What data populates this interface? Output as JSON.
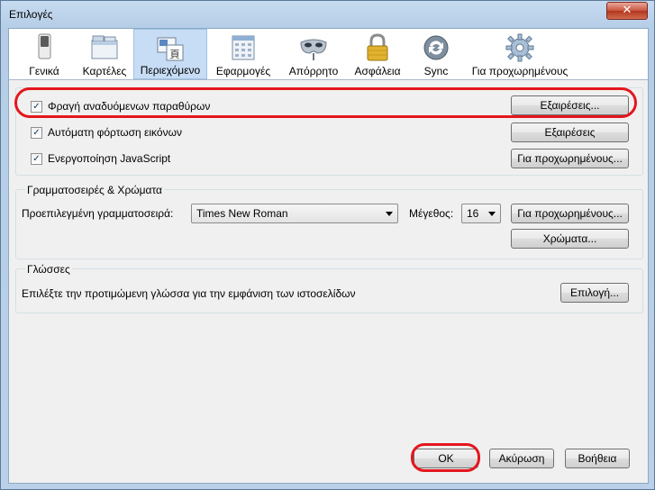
{
  "window": {
    "title": "Επιλογές",
    "close_glyph": "✕"
  },
  "toolbar": {
    "tabs": [
      {
        "label": "Γενικά",
        "icon": "switch-icon"
      },
      {
        "label": "Καρτέλες",
        "icon": "tabs-icon"
      },
      {
        "label": "Περιεχόμενο",
        "icon": "content-icon"
      },
      {
        "label": "Εφαρμογές",
        "icon": "applications-icon"
      },
      {
        "label": "Απόρρητο",
        "icon": "mask-icon"
      },
      {
        "label": "Ασφάλεια",
        "icon": "padlock-icon"
      },
      {
        "label": "Sync",
        "icon": "sync-icon"
      },
      {
        "label": "Για προχωρημένους",
        "icon": "gear-icon"
      }
    ],
    "selected": "Περιεχόμενο"
  },
  "content": {
    "block_popups": {
      "label": "Φραγή αναδυόμενων παραθύρων",
      "checked": true,
      "exceptions": "Εξαιρέσεις..."
    },
    "load_images": {
      "label": "Αυτόματη φόρτωση εικόνων",
      "checked": true,
      "exceptions": "Εξαιρέσεις"
    },
    "javascript": {
      "label": "Ενεργοποίηση JavaScript",
      "checked": true,
      "advanced": "Για προχωρημένους..."
    },
    "check_glyph": "✓"
  },
  "fonts": {
    "group_title": "Γραμματοσειρές & Χρώματα",
    "default_font_label": "Προεπιλεγμένη γραμματοσειρά:",
    "default_font_value": "Times New Roman",
    "size_label": "Μέγεθος:",
    "size_value": "16",
    "advanced": "Για προχωρημένους...",
    "colors": "Χρώματα..."
  },
  "languages": {
    "group_title": "Γλώσσες",
    "description": "Επιλέξτε την προτιμώμενη γλώσσα για την εμφάνιση των ιστοσελίδων",
    "choose": "Επιλογή..."
  },
  "footer": {
    "ok": "OK",
    "cancel": "Ακύρωση",
    "help": "Βοήθεια"
  },
  "colors": {
    "highlight": "#e4161d",
    "selected_tab": "#c7ddf5",
    "dialog_bg": "#f0f0f0"
  }
}
